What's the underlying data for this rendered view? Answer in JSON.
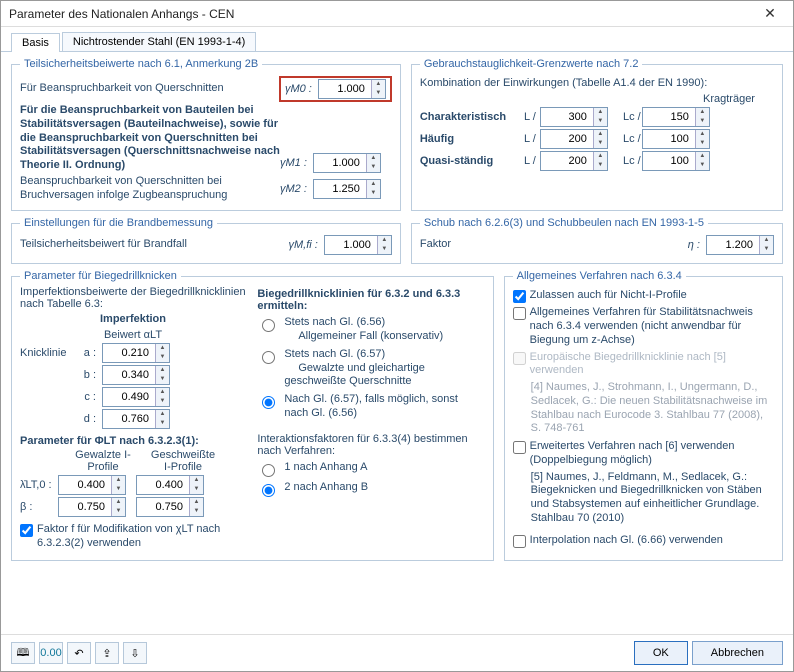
{
  "window_title": "Parameter des Nationalen Anhangs - CEN",
  "tabs": {
    "basis": "Basis",
    "stainless": "Nichtrostender Stahl (EN 1993-1-4)"
  },
  "g1": {
    "legend": "Teilsicherheitsbeiwerte nach 6.1, Anmerkung 2B",
    "r1_lbl": "Für Beanspruchbarkeit von Querschnitten",
    "r1_sym": "γM0 :",
    "r1_val": "1.000",
    "r2_lbl": "Für die Beanspruchbarkeit von Bauteilen bei Stabilitätsversagen (Bauteilnachweise), sowie für die Beanspruchbarkeit von Querschnitten bei Stabilitätsversagen (Querschnittsnachweise nach Theorie II. Ordnung)",
    "r2_sym": "γM1 :",
    "r2_val": "1.000",
    "r3_lbl": "Beanspruchbarkeit von Querschnitten bei Bruchversagen infolge Zugbeanspruchung",
    "r3_sym": "γM2 :",
    "r3_val": "1.250"
  },
  "g2": {
    "legend": "Gebrauchstauglichkeit-Grenzwerte nach 7.2",
    "sub": "Kombination der Einwirkungen (Tabelle A1.4 der EN 1990):",
    "krag": "Kragträger",
    "rows": {
      "char": {
        "lbl": "Charakteristisch",
        "L": "300",
        "Lc": "150"
      },
      "hauf": {
        "lbl": "Häufig",
        "L": "200",
        "Lc": "100"
      },
      "quasi": {
        "lbl": "Quasi-ständig",
        "L": "200",
        "Lc": "100"
      }
    },
    "Lsym": "L /",
    "Lcsym": "Lc /"
  },
  "g3": {
    "legend": "Einstellungen für die Brandbemessung",
    "lbl": "Teilsicherheitsbeiwert für Brandfall",
    "sym": "γM,fi :",
    "val": "1.000"
  },
  "g4": {
    "legend": "Schub nach 6.2.6(3) und Schubbeulen nach EN 1993-1-5",
    "lbl": "Faktor",
    "sym": "η :",
    "val": "1.200"
  },
  "g5": {
    "legend": "Parameter für Biegedrillknicken",
    "hdr1": "Imperfektionsbeiwerte der Biegedrillknicklinien nach Tabelle 6.3:",
    "col1": "Imperfektion",
    "col1b": "Beiwert αLT",
    "knLbl": "Knicklinie",
    "a": "0.210",
    "b": "0.340",
    "c": "0.490",
    "d": "0.760",
    "subhdr": "Parameter für ΦLT nach 6.3.2.3(1):",
    "gcol1": "Gewalzte I-Profile",
    "gcol2": "Geschweißte I-Profile",
    "lambda": "0.400",
    "lambda2": "0.400",
    "beta": "0.750",
    "beta2": "0.750",
    "lambda_sym": "λ̄LT,0 :",
    "beta_sym": "β :",
    "chk_f": "Faktor f für Modifikation von χLT nach 6.3.2.3(2) verwenden",
    "rgrp_title": "Biegedrillknicklinien für 6.3.2 und 6.3.3 ermitteln:",
    "r1": "Stets nach Gl. (6.56)",
    "r1s": "Allgemeiner Fall (konservativ)",
    "r2": "Stets nach Gl. (6.57)",
    "r2s": "Gewalzte und gleichartige geschweißte Querschnitte",
    "r3": "Nach Gl. (6.57), falls möglich, sonst nach Gl. (6.56)",
    "irp_title": "Interaktionsfaktoren für 6.3.3(4) bestimmen nach Verfahren:",
    "ir1": "1 nach Anhang A",
    "ir2": "2 nach Anhang B"
  },
  "g6": {
    "legend": "Allgemeines Verfahren nach 6.3.4",
    "c1": "Zulassen auch für Nicht-I-Profile",
    "c2": "Allgemeines Verfahren für Stabilitäts­nachweis nach 6.3.4 verwenden (nicht anwendbar für Biegung um z-Achse)",
    "c3": "Europäische Biegedrillknicklinie nach [5] verwenden",
    "ref1": "[4] Naumes, J., Strohmann, I., Ungermann, D., Sedlacek, G.: Die neuen Stabilitätsnachweise im Stahlbau nach Eurocode 3. Stahlbau 77 (2008), S. 748-761",
    "c4": "Erweitertes Verfahren nach [6] verwenden (Doppelbiegung möglich)",
    "ref2": "[5] Naumes, J., Feldmann, M., Sedlacek, G.: Biegeknicken und Biegedrillknicken von Stäben und Stabsystemen auf einheitlicher Grundlage. Stahlbau 70 (2010)",
    "c5": "Interpolation nach Gl. (6.66) verwenden"
  },
  "footer": {
    "ok": "OK",
    "cancel": "Abbrechen"
  }
}
